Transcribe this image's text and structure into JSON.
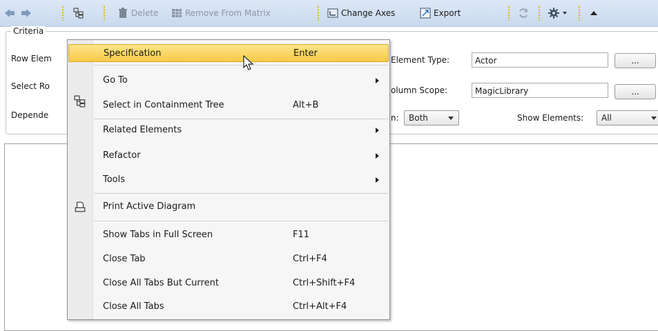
{
  "toolbar": {
    "delete_label": "Delete",
    "remove_label": "Remove From Matrix",
    "change_axes_label": "Change Axes",
    "export_label": "Export"
  },
  "criteria": {
    "title": "Criteria",
    "row_element_label": "Row Elem",
    "select_row_label": "Select Ro",
    "dependency_label": "Depende",
    "column_element_type_label": "Element Type:",
    "column_element_type_value": "Actor",
    "column_scope_label": "olumn Scope:",
    "column_scope_value": "MagicLibrary",
    "direction_label": "n:",
    "direction_value": "Both",
    "show_elements_label": "Show Elements:",
    "show_elements_value": "All",
    "browse_label": "..."
  },
  "menu": {
    "items": [
      {
        "label": "Specification",
        "shortcut": "Enter"
      },
      {
        "label": "Go To",
        "shortcut": ""
      },
      {
        "label": "Select in Containment Tree",
        "shortcut": "Alt+B"
      },
      {
        "label": "Related Elements",
        "shortcut": ""
      },
      {
        "label": "Refactor",
        "shortcut": ""
      },
      {
        "label": "Tools",
        "shortcut": ""
      },
      {
        "label": "Print Active Diagram",
        "shortcut": ""
      },
      {
        "label": "Show Tabs in Full Screen",
        "shortcut": "F11"
      },
      {
        "label": "Close Tab",
        "shortcut": "Ctrl+F4"
      },
      {
        "label": "Close All Tabs But Current",
        "shortcut": "Ctrl+Shift+F4"
      },
      {
        "label": "Close All Tabs",
        "shortcut": "Ctrl+Alt+F4"
      }
    ]
  },
  "colors": {
    "toolbar_bg": "#c9d9ee",
    "menu_highlight": "#f7c948"
  }
}
